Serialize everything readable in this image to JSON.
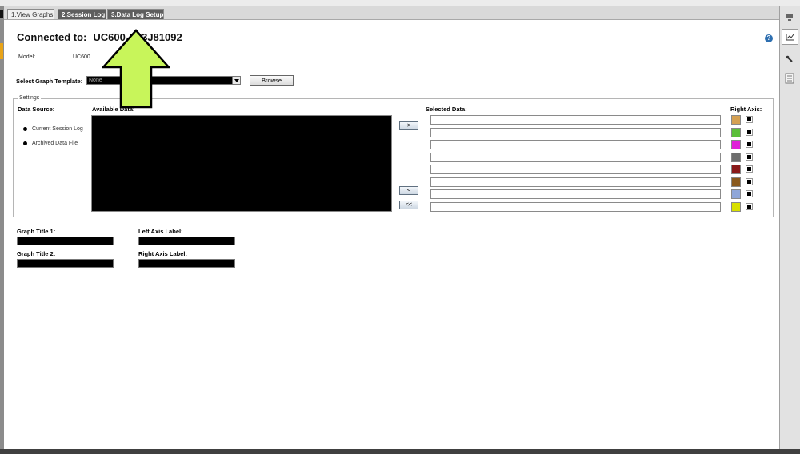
{
  "tabs": [
    {
      "label": "1.View Graphs"
    },
    {
      "label": "2.Session Log"
    },
    {
      "label": "3.Data Log Setup"
    }
  ],
  "header": {
    "connected_label": "Connected to:",
    "device_name": "UC600-E13J81092",
    "help_glyph": "?"
  },
  "model": {
    "label": "Model:",
    "value": "UC600"
  },
  "graph_template": {
    "label": "Select Graph Template:",
    "selected": "None",
    "browse_label": "Browse"
  },
  "settings": {
    "legend": "Settings",
    "data_source_label": "Data Source:",
    "sources": [
      {
        "label": "Current Session Log"
      },
      {
        "label": "Archived Data File"
      }
    ],
    "available_label": "Available Data:",
    "selected_label": "Selected Data:",
    "right_axis_label": "Right Axis:",
    "buttons": {
      "add": ">",
      "remove": "<",
      "remove_all": "<<"
    },
    "series_colors": [
      "#d4a052",
      "#5cbf3a",
      "#e020d8",
      "#6e6e6e",
      "#8a1a1a",
      "#8a5a1e",
      "#8fa6d8",
      "#d8e000"
    ]
  },
  "graph_labels": {
    "title1": "Graph Title 1:",
    "title2": "Graph Title 2:",
    "left_axis": "Left Axis Label:",
    "right_axis": "Right Axis Label:"
  },
  "icons": {
    "rail": [
      "tray-icon",
      "line-graph-icon",
      "wrench-icon",
      "document-list-icon"
    ],
    "overlay": "arrow-up-icon"
  },
  "colors": {
    "overlay_arrow_fill": "#c8f55a",
    "active_tab": "#5e5e5e"
  }
}
